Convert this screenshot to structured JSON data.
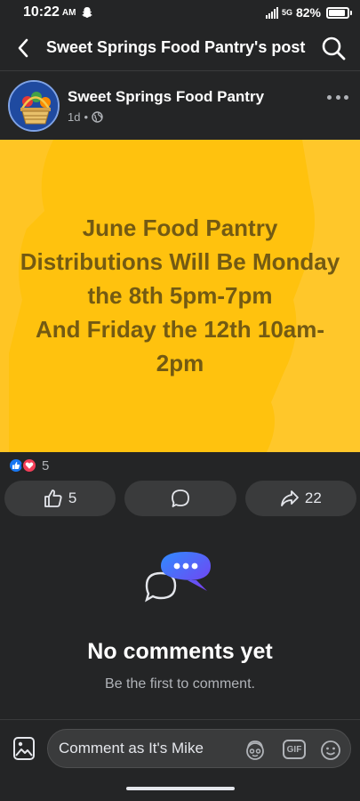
{
  "status_bar": {
    "time": "10:22",
    "ampm": "AM",
    "network": "5G",
    "battery": "82%",
    "battery_level": 0.82
  },
  "header": {
    "title": "Sweet Springs Food Pantry's post"
  },
  "post": {
    "author": "Sweet Springs Food Pantry",
    "age": "1d",
    "separator": "•",
    "image_text": [
      "June Food Pantry",
      "Distributions Will Be Monday",
      "the 8th 5pm-7pm",
      "And Friday the 12th 10am-",
      "2pm"
    ],
    "reaction_count": "5"
  },
  "actions": {
    "like_count": "5",
    "share_count": "22"
  },
  "comments": {
    "empty_title": "No comments yet",
    "empty_subtitle": "Be the first to comment."
  },
  "composer": {
    "placeholder": "Comment as It's Mike",
    "gif_label": "GIF"
  },
  "colors": {
    "background": "#242526",
    "image_bg": "#ffc20e",
    "image_text": "#735a13",
    "like_blue": "#1877f2",
    "love_red": "#f33e58"
  }
}
